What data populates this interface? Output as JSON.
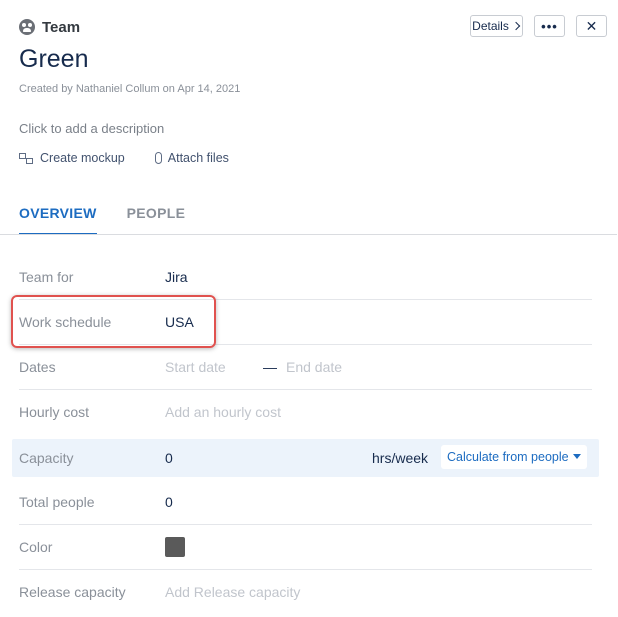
{
  "header": {
    "icon": "team-icon",
    "label": "Team",
    "details_label": "Details",
    "more_label": "•••",
    "close_label": "✕"
  },
  "title": "Green",
  "created_text": "Created by Nathaniel Collum on Apr 14, 2021",
  "description_placeholder": "Click to add a description",
  "actions": {
    "create_mockup": "Create mockup",
    "attach_files": "Attach files"
  },
  "tabs": [
    {
      "label": "OVERVIEW",
      "active": true
    },
    {
      "label": "PEOPLE",
      "active": false
    }
  ],
  "fields": {
    "team_for": {
      "label": "Team for",
      "value": "Jira"
    },
    "work_schedule": {
      "label": "Work schedule",
      "value": "USA"
    },
    "dates": {
      "label": "Dates",
      "start_placeholder": "Start date",
      "separator": "—",
      "end_placeholder": "End date"
    },
    "hourly_cost": {
      "label": "Hourly cost",
      "placeholder": "Add an hourly cost"
    },
    "capacity": {
      "label": "Capacity",
      "value": "0",
      "unit": "hrs/week",
      "calc_label": "Calculate from people"
    },
    "total_people": {
      "label": "Total people",
      "value": "0"
    },
    "color": {
      "label": "Color",
      "swatch": "#5a5a5a"
    },
    "release_capacity": {
      "label": "Release capacity",
      "placeholder": "Add Release capacity"
    }
  },
  "colors": {
    "accent": "#1d6cc1",
    "highlight_border": "#e0524f",
    "capacity_bg": "#ecf3fb"
  }
}
